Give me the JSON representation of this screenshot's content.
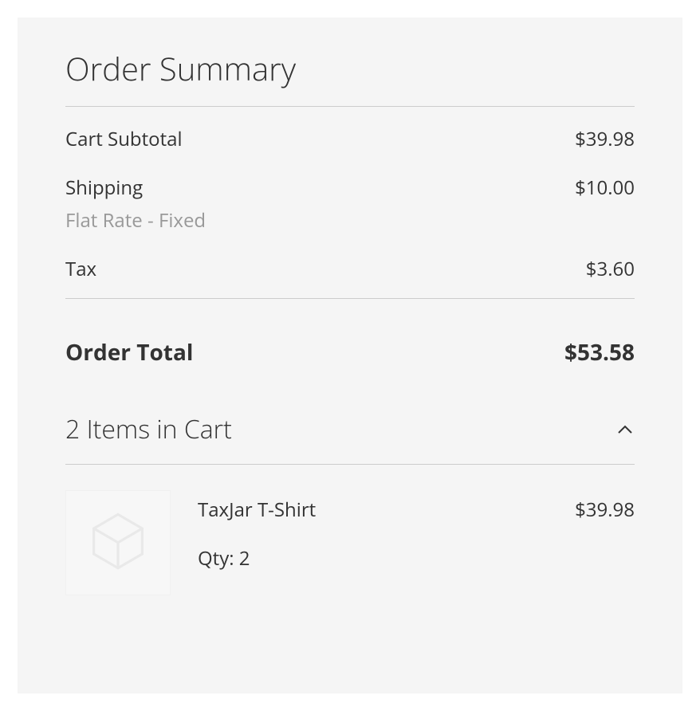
{
  "summary": {
    "title": "Order Summary",
    "subtotal": {
      "label": "Cart Subtotal",
      "value": "$39.98"
    },
    "shipping": {
      "label": "Shipping",
      "sublabel": "Flat Rate - Fixed",
      "value": "$10.00"
    },
    "tax": {
      "label": "Tax",
      "value": "$3.60"
    },
    "total": {
      "label": "Order Total",
      "value": "$53.58"
    }
  },
  "cart": {
    "header": "2 Items in Cart",
    "items": [
      {
        "name": "TaxJar T-Shirt",
        "qty_label": "Qty: 2",
        "price": "$39.98"
      }
    ]
  }
}
